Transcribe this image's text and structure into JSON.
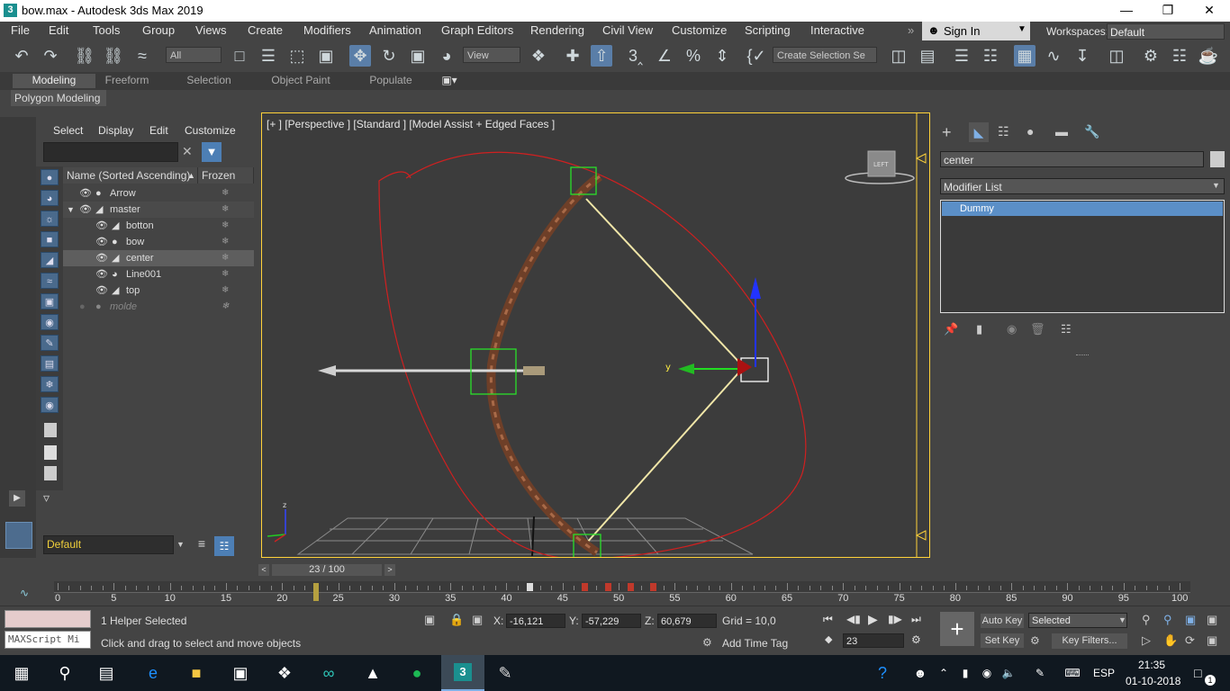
{
  "window": {
    "title": "bow.max - Autodesk 3ds Max 2019",
    "app_icon": "3"
  },
  "menu": [
    "File",
    "Edit",
    "Tools",
    "Group",
    "Views",
    "Create",
    "Modifiers",
    "Animation",
    "Graph Editors",
    "Rendering",
    "Civil View",
    "Customize",
    "Scripting",
    "Interactive"
  ],
  "account": {
    "sign_in": "Sign In",
    "workspaces_label": "Workspaces:",
    "workspace_value": "Default"
  },
  "toolbar": {
    "filter_value": "All",
    "view_value": "View",
    "selection_set_placeholder": "Create Selection Se"
  },
  "ribbon": {
    "tabs": [
      "Modeling",
      "Freeform",
      "Selection",
      "Object Paint",
      "Populate"
    ],
    "active_tab": "Polygon Modeling"
  },
  "scene_explorer": {
    "tabs": [
      "Select",
      "Display",
      "Edit",
      "Customize"
    ],
    "col_name": "Name (Sorted Ascending)",
    "col_frozen": "Frozen",
    "rows": [
      {
        "name": "Arrow"
      },
      {
        "name": "master"
      },
      {
        "name": "botton"
      },
      {
        "name": "bow"
      },
      {
        "name": "center"
      },
      {
        "name": "Line001"
      },
      {
        "name": "top"
      },
      {
        "name": "molde"
      }
    ],
    "layer_value": "Default"
  },
  "viewport": {
    "label": "[+ ] [Perspective ] [Standard ] [Model Assist + Edged Faces ]",
    "viewcube_label": "LEFT",
    "axis_y": "y",
    "axis_z": "z"
  },
  "command_panel": {
    "object_name": "center",
    "modifier_list": "Modifier List",
    "stack_item": "Dummy",
    "accent": "#5b8fc7"
  },
  "timeline": {
    "frame_display": "23 / 100",
    "tick_labels": [
      "0",
      "5",
      "10",
      "15",
      "20",
      "25",
      "30",
      "35",
      "40",
      "45",
      "50",
      "55",
      "60",
      "65",
      "70",
      "75",
      "80",
      "85",
      "90",
      "95",
      "100"
    ]
  },
  "status": {
    "selection_text": "1 Helper Selected",
    "prompt_text": "Click and drag to select and move objects",
    "maxscript": "MAXScript Mi",
    "x_label": "X:",
    "x_value": "-16,121",
    "y_label": "Y:",
    "y_value": "-57,229",
    "z_label": "Z:",
    "z_value": "60,679",
    "grid": "Grid = 10,0",
    "add_time_tag": "Add Time Tag",
    "auto_key": "Auto Key",
    "set_key": "Set Key",
    "key_mode": "Selected",
    "key_filters": "Key Filters...",
    "current_frame": "23"
  },
  "taskbar": {
    "language": "ESP",
    "time": "21:35",
    "date": "01-10-2018",
    "notifications": "1"
  }
}
